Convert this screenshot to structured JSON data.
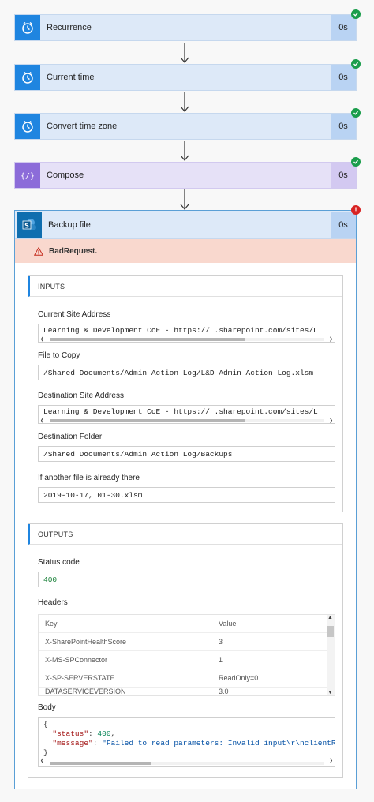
{
  "steps": [
    {
      "title": "Recurrence",
      "duration": "0s",
      "icon": "timer-icon"
    },
    {
      "title": "Current time",
      "duration": "0s",
      "icon": "timer-icon"
    },
    {
      "title": "Convert time zone",
      "duration": "0s",
      "icon": "timer-icon"
    },
    {
      "title": "Compose",
      "duration": "0s",
      "icon": "variable-braces-icon"
    }
  ],
  "backup": {
    "title": "Backup file",
    "duration": "0s",
    "error": "BadRequest.",
    "inputs": {
      "heading": "INPUTS",
      "current_site_label": "Current Site Address",
      "current_site_value": "Learning & Development CoE - https://          .sharepoint.com/sites/L",
      "file_to_copy_label": "File to Copy",
      "file_to_copy_value": "/Shared Documents/Admin Action Log/L&D Admin Action Log.xlsm",
      "dest_site_label": "Destination Site Address",
      "dest_site_value": "Learning & Development CoE - https://          .sharepoint.com/sites/L",
      "dest_folder_label": "Destination Folder",
      "dest_folder_value": "/Shared Documents/Admin Action Log/Backups",
      "if_exists_label": "If another file is already there",
      "if_exists_value": "2019-10-17, 01-30.xlsm"
    },
    "outputs": {
      "heading": "OUTPUTS",
      "status_label": "Status code",
      "status_value": "400",
      "headers_label": "Headers",
      "key_col": "Key",
      "value_col": "Value",
      "rows": [
        {
          "k": "X-SharePointHealthScore",
          "v": "3"
        },
        {
          "k": "X-MS-SPConnector",
          "v": "1"
        },
        {
          "k": "X-SP-SERVERSTATE",
          "v": "ReadOnly=0"
        },
        {
          "k": "DATASERVICEVERSION",
          "v": "3.0"
        }
      ],
      "body_label": "Body",
      "body_open": "{",
      "body_status_key": "\"status\"",
      "body_status_val": "400",
      "body_message_key": "\"message\"",
      "body_message_val": "\"Failed to read parameters: Invalid input\\r\\nclientRequestId",
      "body_close": "}"
    }
  }
}
